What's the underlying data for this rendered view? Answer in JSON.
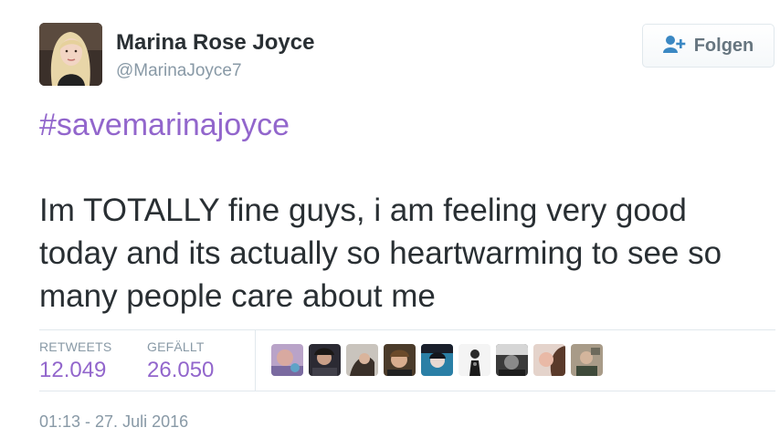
{
  "author": {
    "name": "Marina Rose Joyce",
    "handle": "@MarinaJoyce7"
  },
  "follow_button": {
    "label": "Folgen",
    "icon": "follow-user-plus-icon"
  },
  "tweet": {
    "hashtag": "#savemarinajoyce",
    "text_lines": [
      "Im TOTALLY fine guys, i am feeling very good",
      "today and its actually so heartwarming to see so",
      "many people care about me"
    ]
  },
  "stats": {
    "retweets_label": "RETWEETS",
    "retweets_value": "12.049",
    "likes_label": "GEFÄLLT",
    "likes_value": "26.050"
  },
  "likers_avatars_count": 9,
  "timestamp": "01:13 - 27. Juli 2016",
  "colors": {
    "link": "#9266cc",
    "text": "#292f33",
    "muted": "#8899a6",
    "border": "#e1e8ed"
  }
}
